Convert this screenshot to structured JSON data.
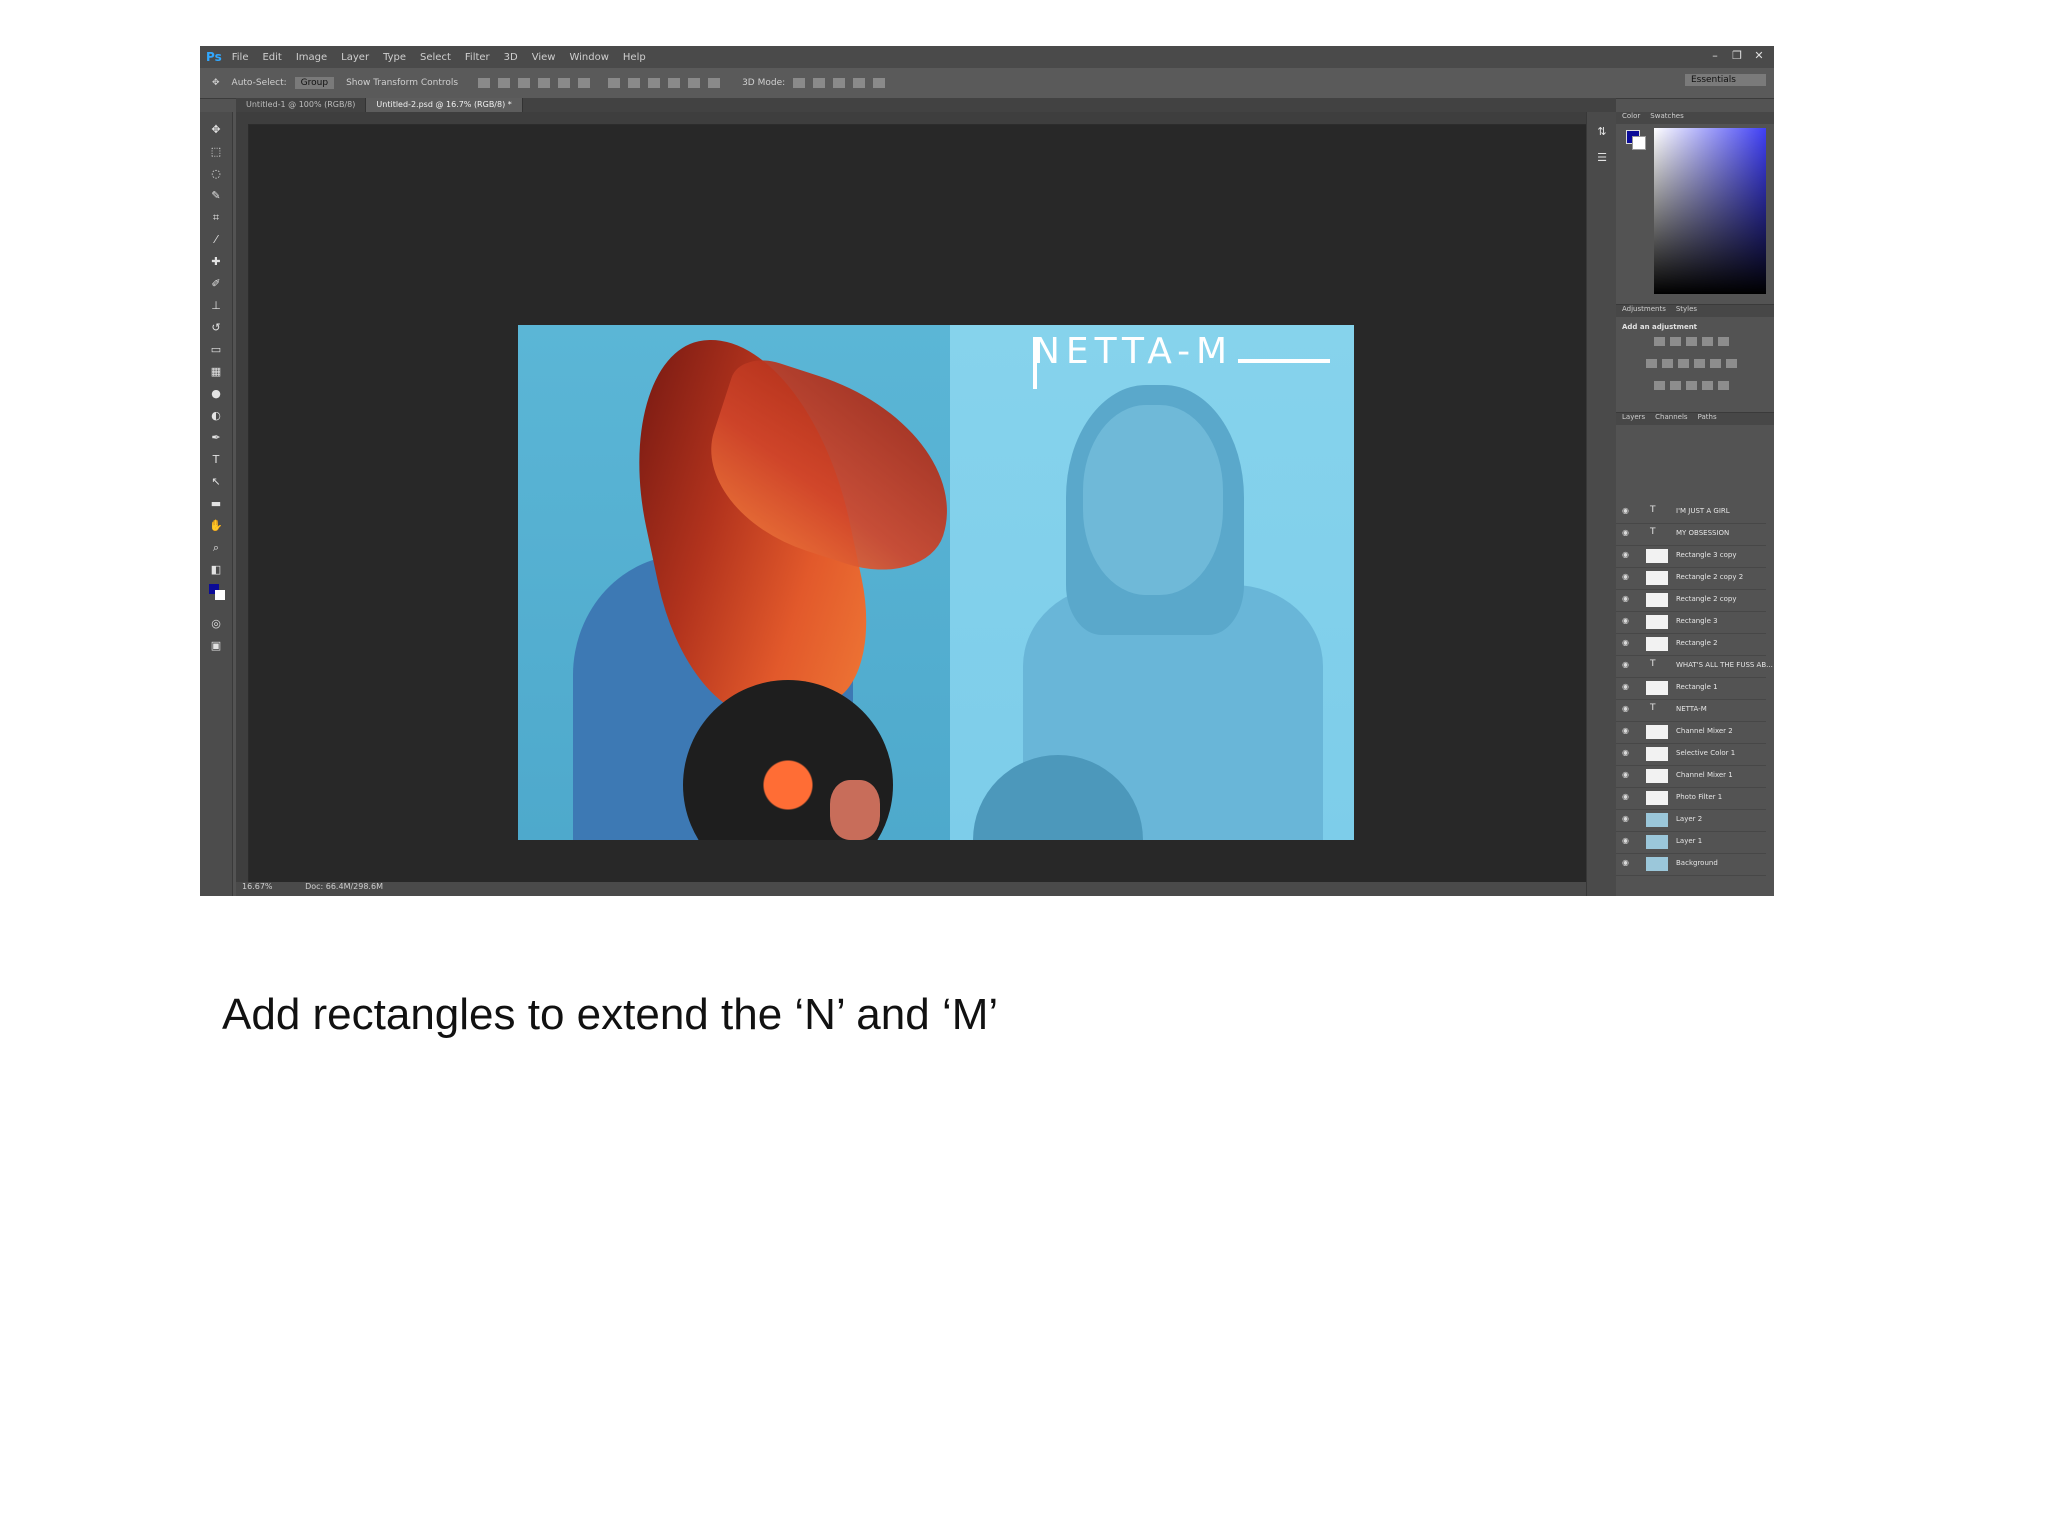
{
  "app": {
    "name": "Ps",
    "menu": [
      "File",
      "Edit",
      "Image",
      "Layer",
      "Type",
      "Select",
      "Filter",
      "3D",
      "View",
      "Window",
      "Help"
    ],
    "window_controls": [
      "–",
      "❐",
      "✕"
    ],
    "options_bar": {
      "auto_select_label": "Auto-Select:",
      "auto_select_value": "Group",
      "transform_controls_label": "Show Transform Controls",
      "mode_label": "3D Mode:",
      "workspace": "Essentials"
    },
    "tabs": [
      "Untitled-1 @ 100% (RGB/8)",
      "Untitled-2.psd @ 16.7% (RGB/8) *"
    ],
    "status": {
      "zoom": "16.67%",
      "doc": "Doc: 66.4M/298.6M"
    },
    "panels": {
      "color_tabs": [
        "Color",
        "Swatches"
      ],
      "adjustments_tabs": [
        "Adjustments",
        "Styles"
      ],
      "adjustments_title": "Add an adjustment",
      "layers_tabs": [
        "Layers",
        "Channels",
        "Paths"
      ],
      "layers": [
        {
          "name": "I'M JUST A GIRL",
          "type": "text"
        },
        {
          "name": "MY OBSESSION",
          "type": "text"
        },
        {
          "name": "Rectangle 3 copy",
          "type": "shape"
        },
        {
          "name": "Rectangle 2 copy 2",
          "type": "shape"
        },
        {
          "name": "Rectangle 2 copy",
          "type": "shape"
        },
        {
          "name": "Rectangle 3",
          "type": "shape"
        },
        {
          "name": "Rectangle 2",
          "type": "shape"
        },
        {
          "name": "WHAT'S ALL THE FUSS AB...",
          "type": "text"
        },
        {
          "name": "Rectangle 1",
          "type": "shape"
        },
        {
          "name": "NETTA-M",
          "type": "text"
        },
        {
          "name": "Channel Mixer 2",
          "type": "adjustment"
        },
        {
          "name": "Selective Color 1",
          "type": "adjustment"
        },
        {
          "name": "Channel Mixer 1",
          "type": "adjustment"
        },
        {
          "name": "Photo Filter 1",
          "type": "adjustment"
        },
        {
          "name": "Layer 2",
          "type": "image"
        },
        {
          "name": "Layer 1",
          "type": "image"
        },
        {
          "name": "Background",
          "type": "image"
        }
      ]
    }
  },
  "document": {
    "title_text": "NETTA-M"
  },
  "colors": {
    "foreground": "#0b0b98",
    "background": "#ffffff"
  },
  "caption": "Add rectangles to extend the ‘N’ and ‘M’"
}
